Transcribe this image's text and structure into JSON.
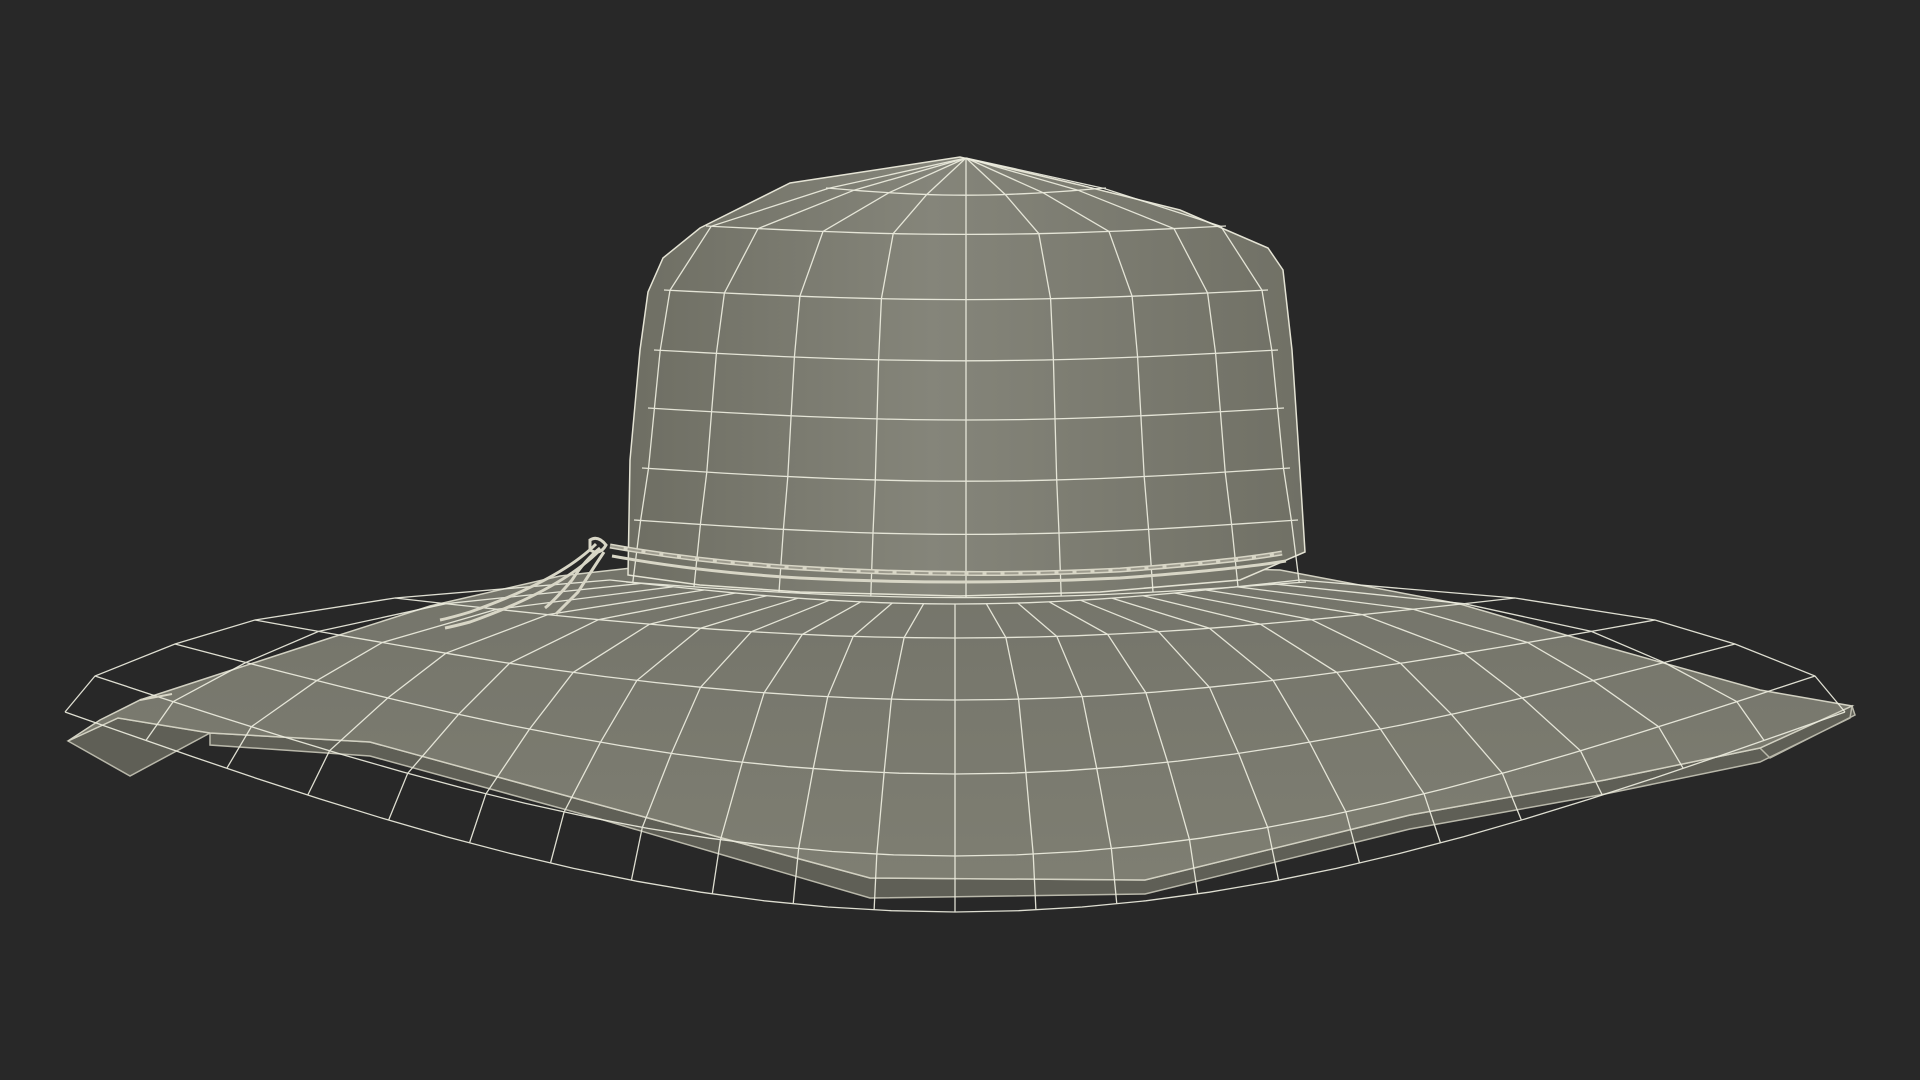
{
  "scene": {
    "subject": "wide-brim-sun-hat-wireframe",
    "render_mode": "wireframe-on-shaded",
    "colors": {
      "background": "#282828",
      "surface_light": "#85857a",
      "surface_mid": "#7b7b6f",
      "surface_dark": "#6a6a5f",
      "rim_edge": "#b9b8aa",
      "wire": "#eeeee0",
      "band": "#d8d6c6"
    }
  }
}
